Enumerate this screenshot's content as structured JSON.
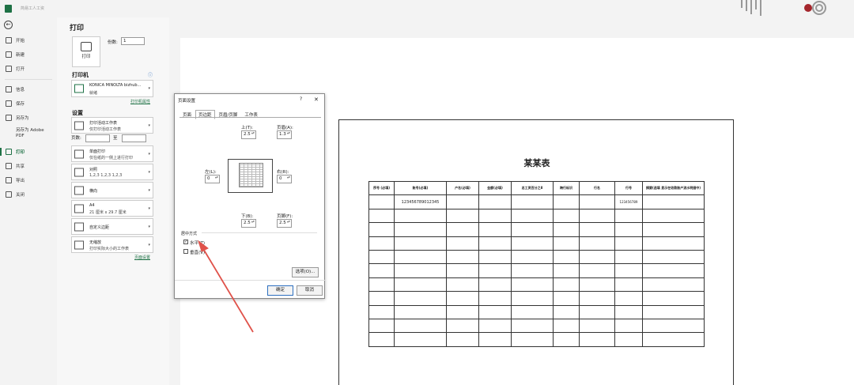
{
  "window": {
    "title": "简易工人工资"
  },
  "nav": {
    "items": [
      {
        "label": "开始"
      },
      {
        "label": "新建"
      },
      {
        "label": "打开"
      },
      {
        "label": "信息"
      },
      {
        "label": "保存"
      },
      {
        "label": "另存为"
      },
      {
        "label": "另存为 Adobe PDF"
      },
      {
        "label": "打印"
      },
      {
        "label": "共享"
      },
      {
        "label": "导出"
      },
      {
        "label": "关闭"
      }
    ],
    "active": "打印"
  },
  "print_panel": {
    "title": "打印",
    "print_button": "打印",
    "copies_label": "份数:",
    "copies_value": "1",
    "printer_heading": "打印机",
    "printer_name": "KONICA MINOLTA bizhub...",
    "printer_status": "就绪",
    "printer_props_link": "打印机属性",
    "settings_heading": "设置",
    "settings": [
      {
        "l1": "打印活动工作表",
        "l2": "仅打印活动工作表"
      },
      {
        "l1": "单面打印",
        "l2": "仅在纸的一侧上进行打印"
      },
      {
        "l1": "对照",
        "l2": "1,2,3    1,2,3    1,2,3"
      },
      {
        "l1": "横向",
        "l2": ""
      },
      {
        "l1": "A4",
        "l2": "21 厘米 x 29.7 厘米"
      },
      {
        "l1": "自定义边距",
        "l2": ""
      },
      {
        "l1": "无缩放",
        "l2": "打印实际大小的工作表"
      }
    ],
    "pages_label": "页数:",
    "to_label": "至",
    "page_setup_link": "页面设置"
  },
  "dialog": {
    "title": "页面设置",
    "help": "?",
    "close": "✕",
    "tabs": [
      "页面",
      "页边距",
      "页眉/页脚",
      "工作表"
    ],
    "active_tab": "页边距",
    "top_label": "上(T):",
    "top_value": "2.5",
    "header_label": "页眉(A):",
    "header_value": "1.3",
    "left_label": "左(L):",
    "left_value": "0",
    "right_label": "右(R):",
    "right_value": "0",
    "bottom_label": "下(B):",
    "bottom_value": "2.5",
    "footer_label": "页脚(F):",
    "footer_value": "2.5",
    "center_heading": "居中方式",
    "horizontal_label": "水平(Z)",
    "horizontal_checked": true,
    "vertical_label": "垂直(V)",
    "vertical_checked": false,
    "options_button": "选项(O)...",
    "ok_button": "确定",
    "cancel_button": "取消"
  },
  "sheet": {
    "title": "某某表",
    "headers": [
      "序号\n(必填)",
      "账号(必填)",
      "户名(必填)",
      "金额(必填)",
      "总工资百分之8",
      "跨行标识",
      "行名",
      "行号",
      "摘要(选填 显示在收款账户流水明细中)"
    ],
    "row1": [
      "",
      "123456789012345",
      "",
      "",
      "",
      "",
      "",
      "123456789",
      ""
    ],
    "empty_rows": 10
  },
  "colors": {
    "accent": "#1e7145",
    "arrow": "#e0524a"
  }
}
